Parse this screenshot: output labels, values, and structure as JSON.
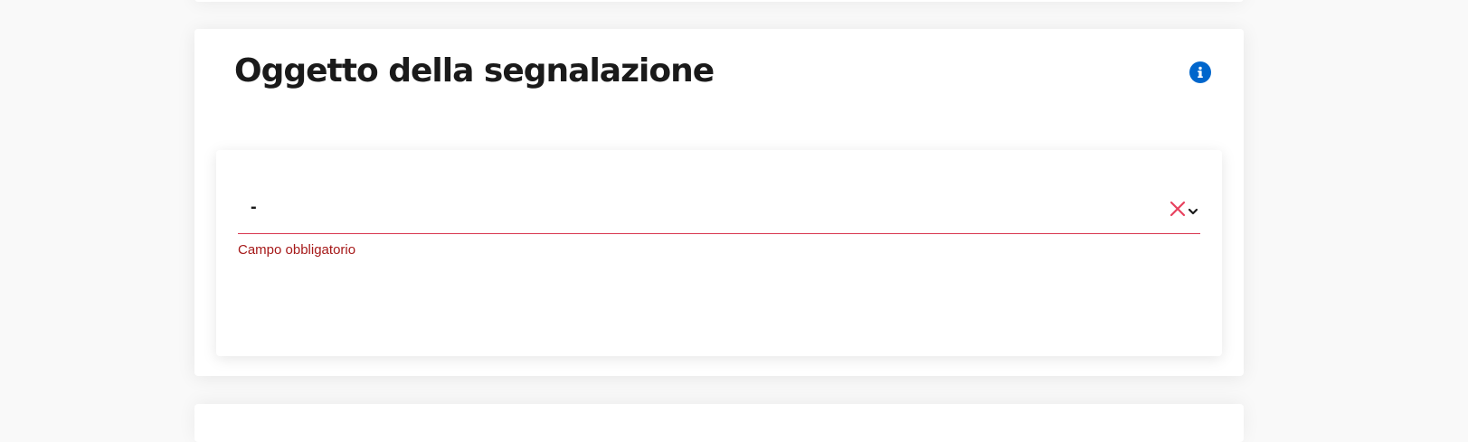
{
  "section": {
    "title": "Oggetto della segnalazione"
  },
  "subject_select": {
    "selected_value": "-",
    "error_message": "Campo obbligatorio"
  },
  "icons": {
    "info": "info-icon",
    "clear": "close-icon",
    "dropdown": "chevron-down-icon"
  },
  "colors": {
    "accent": "#0066cc",
    "error": "#d9364f",
    "error_text": "#a61919",
    "title": "#1a1a1a"
  }
}
